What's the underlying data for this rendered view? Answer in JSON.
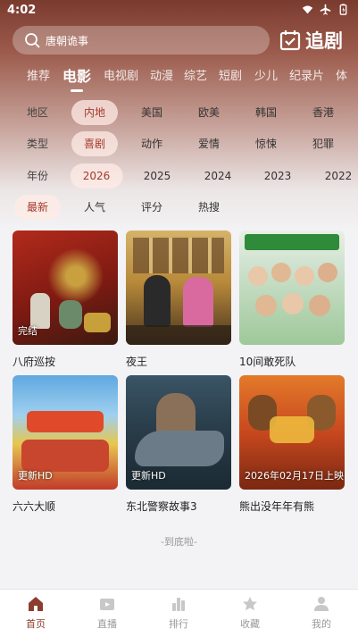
{
  "status": {
    "time": "4:02"
  },
  "search": {
    "placeholder": "唐朝诡事"
  },
  "brand": {
    "name": "追剧"
  },
  "tabs": [
    "推荐",
    "电影",
    "电视剧",
    "动漫",
    "综艺",
    "短剧",
    "少儿",
    "纪录片",
    "体"
  ],
  "active_tab": "电影",
  "filters": {
    "region": {
      "label": "地区",
      "options": [
        "内地",
        "美国",
        "欧美",
        "韩国",
        "香港"
      ],
      "selected": "内地"
    },
    "genre": {
      "label": "类型",
      "options": [
        "喜剧",
        "动作",
        "爱情",
        "惊悚",
        "犯罪"
      ],
      "selected": "喜剧"
    },
    "year": {
      "label": "年份",
      "options": [
        "2026",
        "2025",
        "2024",
        "2023",
        "2022"
      ],
      "selected": "2026"
    },
    "sort": {
      "options": [
        "最新",
        "人气",
        "评分",
        "热搜"
      ],
      "selected": "最新"
    }
  },
  "movies": [
    {
      "title": "八府巡按",
      "badge": "完结"
    },
    {
      "title": "夜王",
      "badge": ""
    },
    {
      "title": "10间敢死队",
      "badge": ""
    },
    {
      "title": "六六大顺",
      "badge": "更新HD"
    },
    {
      "title": "东北警察故事3",
      "badge": "更新HD"
    },
    {
      "title": "熊出没年年有熊",
      "badge": "2026年02月17日上映"
    }
  ],
  "footer_text": "-到底啦-",
  "nav": [
    {
      "label": "首页",
      "icon": "home-icon"
    },
    {
      "label": "直播",
      "icon": "tv-icon"
    },
    {
      "label": "排行",
      "icon": "chart-icon"
    },
    {
      "label": "收藏",
      "icon": "star-icon"
    },
    {
      "label": "我的",
      "icon": "user-icon"
    }
  ],
  "nav_active": "首页",
  "colors": {
    "accent": "#8c3d2f",
    "selected_text": "#a33a2c"
  }
}
